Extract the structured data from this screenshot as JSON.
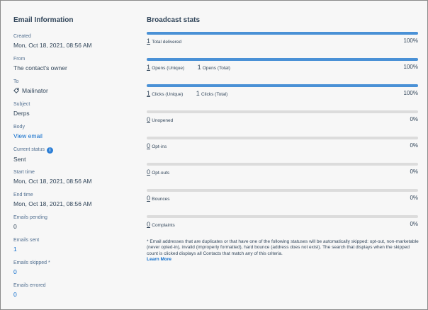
{
  "email_info": {
    "title": "Email Information",
    "fields": [
      {
        "label": "Created",
        "value": "Mon, Oct 18, 2021, 08:56 AM"
      },
      {
        "label": "From",
        "value": "The contact's owner"
      },
      {
        "label": "To",
        "value": "Mailinator"
      },
      {
        "label": "Subject",
        "value": "Derps"
      },
      {
        "label": "Body",
        "value": "View email"
      },
      {
        "label": "Current status",
        "value": "Sent"
      },
      {
        "label": "Start time",
        "value": "Mon, Oct 18, 2021, 08:56 AM"
      },
      {
        "label": "End time",
        "value": "Mon, Oct 18, 2021, 08:56 AM"
      },
      {
        "label": "Emails pending",
        "value": "0"
      },
      {
        "label": "Emails sent",
        "value": "1"
      },
      {
        "label": "Emails skipped *",
        "value": "0"
      },
      {
        "label": "Emails errored",
        "value": "0"
      }
    ]
  },
  "broadcast": {
    "title": "Broadcast stats",
    "stats": [
      {
        "num": "1",
        "label": "Total delivered",
        "pct": "100%",
        "fill": 1.0
      },
      {
        "num": "1",
        "label": "Opens (Unique)",
        "num2": "1",
        "label2": "Opens (Total)",
        "pct": "100%",
        "fill": 1.0
      },
      {
        "num": "1",
        "label": "Clicks (Unique)",
        "num2": "1",
        "label2": "Clicks (Total)",
        "pct": "100%",
        "fill": 1.0
      },
      {
        "num": "0",
        "label": "Unopened",
        "pct": "0%",
        "fill": 0
      },
      {
        "num": "0",
        "label": "Opt-ins",
        "pct": "0%",
        "fill": 0
      },
      {
        "num": "0",
        "label": "Opt-outs",
        "pct": "0%",
        "fill": 0
      },
      {
        "num": "0",
        "label": "Bounces",
        "pct": "0%",
        "fill": 0
      },
      {
        "num": "0",
        "label": "Complaints",
        "pct": "0%",
        "fill": 0
      }
    ],
    "note": "* Email addresses that are duplicates or that have one of the following statuses will be automatically skipped: opt-out, non-marketable (never opted-in), invalid (improperly formatted), hard bounce (address does not exist). The search that displays when the skipped count is clicked displays all Contacts that match any of this criteria.",
    "learn_more": "Learn More"
  },
  "colors": {
    "accent": "#4a91d6",
    "link": "#0b6bcb",
    "text": "#33475b",
    "track": "#dcdcdc"
  },
  "icons": {
    "to": "tag-icon",
    "status": "info-icon"
  }
}
